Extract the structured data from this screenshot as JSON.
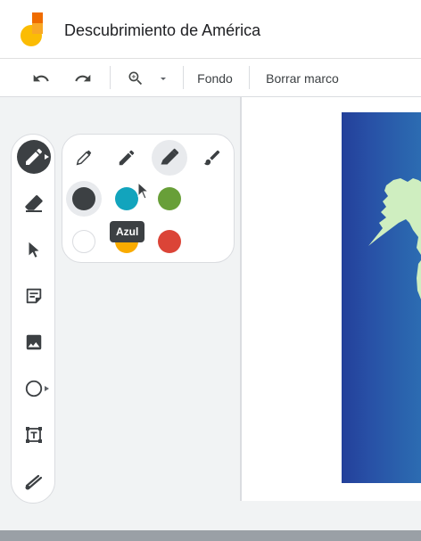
{
  "doc": {
    "title": "Descubrimiento de América"
  },
  "toolbar": {
    "undo_icon": "undo-icon",
    "redo_icon": "redo-icon",
    "zoom_icon": "zoom-in-icon",
    "zoom_dropdown_icon": "caret-down-icon",
    "background_label": "Fondo",
    "clear_frame_label": "Borrar marco"
  },
  "side_tools": [
    {
      "name": "pen",
      "icon": "pen-icon",
      "active": true
    },
    {
      "name": "eraser",
      "icon": "eraser-icon"
    },
    {
      "name": "select",
      "icon": "arrow-cursor-icon"
    },
    {
      "name": "sticky-note",
      "icon": "sticky-note-icon"
    },
    {
      "name": "image",
      "icon": "image-icon"
    },
    {
      "name": "shape",
      "icon": "circle-shape-icon"
    },
    {
      "name": "text-box",
      "icon": "text-box-icon"
    },
    {
      "name": "laser",
      "icon": "laser-icon"
    }
  ],
  "pen_panel": {
    "pen_types": [
      "pen-icon",
      "marker-icon",
      "highlighter-icon",
      "brush-icon"
    ],
    "selected_pen_type": 2,
    "colors": [
      {
        "name": "Negro",
        "hex": "#3c4043"
      },
      {
        "name": "Azul",
        "hex": "#12a4bd"
      },
      {
        "name": "Verde",
        "hex": "#689f38"
      },
      {
        "name": "Blanco",
        "hex": "#ffffff"
      },
      {
        "name": "Amarillo",
        "hex": "#f9ab00"
      },
      {
        "name": "Rojo",
        "hex": "#db4437"
      }
    ],
    "selected_color": "Negro"
  },
  "tooltip": {
    "text": "Azul"
  },
  "theme": {
    "map_blue": "#2a4fa3",
    "land": "#cfeec0"
  }
}
